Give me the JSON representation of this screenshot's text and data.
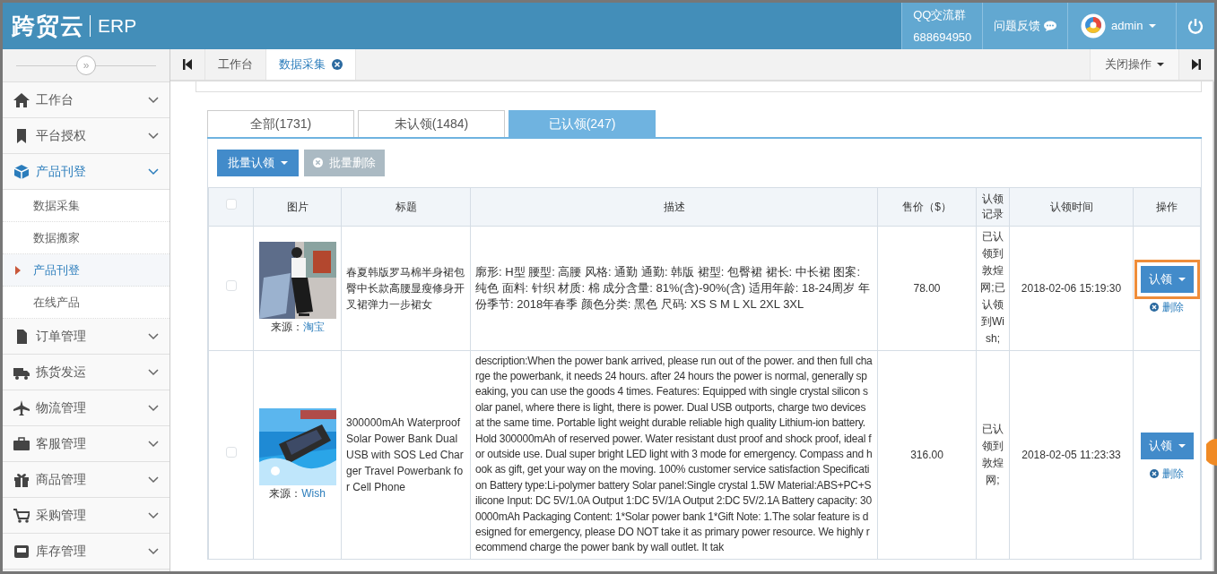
{
  "header": {
    "logo": "跨贸云",
    "product": "ERP",
    "qq_label": "QQ交流群",
    "qq_number": "688694950",
    "feedback": "问题反馈",
    "user": "admin"
  },
  "tab_bar": {
    "tabs": [
      {
        "label": "工作台",
        "selected": false,
        "closable": false
      },
      {
        "label": "数据采集",
        "selected": true,
        "closable": true
      }
    ],
    "close_menu": "关闭操作"
  },
  "sidebar": {
    "collapse": "»",
    "items": [
      {
        "label": "工作台",
        "expanded": false
      },
      {
        "label": "平台授权",
        "expanded": false
      },
      {
        "label": "产品刊登",
        "expanded": true,
        "children": [
          {
            "label": "数据采集",
            "selected": false
          },
          {
            "label": "数据搬家",
            "selected": false
          },
          {
            "label": "产品刊登",
            "selected": true
          },
          {
            "label": "在线产品",
            "selected": false
          }
        ]
      },
      {
        "label": "订单管理",
        "expanded": false
      },
      {
        "label": "拣货发运",
        "expanded": false
      },
      {
        "label": "物流管理",
        "expanded": false
      },
      {
        "label": "客服管理",
        "expanded": false
      },
      {
        "label": "商品管理",
        "expanded": false
      },
      {
        "label": "采购管理",
        "expanded": false
      },
      {
        "label": "库存管理",
        "expanded": false
      }
    ]
  },
  "filter_tabs": [
    {
      "label": "全部(1731)",
      "selected": false
    },
    {
      "label": "未认领(1484)",
      "selected": false
    },
    {
      "label": "已认领(247)",
      "selected": true
    }
  ],
  "toolbar": {
    "batch_claim": "批量认领",
    "batch_delete": {
      "label": "批量删除",
      "disabled": true
    }
  },
  "table": {
    "select_all": false,
    "columns": [
      "图片",
      "标题",
      "描述",
      "售价（$）",
      "认领记录",
      "认领时间",
      "操作"
    ],
    "rows": [
      {
        "checked": false,
        "source_label": "来源：",
        "source": "淘宝",
        "title": "春夏韩版罗马棉半身裙包臀中长款高腰显瘦修身开叉裙弹力一步裙女",
        "description": "廓形: H型 腰型: 高腰 风格: 通勤 通勤: 韩版 裙型: 包臀裙 裙长: 中长裙 图案: 纯色 面料: 针织 材质: 棉 成分含量: 81%(含)-90%(含) 适用年龄: 18-24周岁 年份季节: 2018年春季 颜色分类: 黑色 尺码: XS S M L XL 2XL 3XL",
        "price": "78.00",
        "claim_record": "已认领到敦煌网;已认领到Wish;",
        "claim_time": "2018-02-06 15:19:30",
        "action": "认领",
        "delete": "删除",
        "highlighted": true
      },
      {
        "checked": false,
        "source_label": "来源：",
        "source": "Wish",
        "title": "300000mAh Waterproof Solar Power Bank Dual USB with SOS Led Charger Travel Powerbank for Cell Phone",
        "description": "description:When the power bank arrived, please run out of the power. and then full charge the powerbank, it needs 24 hours. after 24 hours the power is normal, generally speaking, you can use the goods 4 times. Features: Equipped with single crystal silicon solar panel, where there is light, there is power. Dual USB outports, charge two devices at the same time. Portable light weight durable reliable high quality Lithium-ion battery. Hold 300000mAh of reserved power. Water resistant dust proof and shock proof, ideal for outside use. Dual super bright LED light with 3 mode for emergency. Compass and hook as gift, get your way on the moving. 100% customer service satisfaction Specification Battery type:Li-polymer battery Solar panel:Single crystal 1.5W Material:ABS+PC+Silicone Input: DC 5V/1.0A Output 1:DC 5V/1A Output 2:DC 5V/2.1A Battery capacity: 300000mAh Packaging Content: 1*Solar power bank 1*Gift Note: 1.The solar feature is designed for emergency, please DO NOT take it as primary power resource. We highly recommend charge the power bank by wall outlet. It tak",
        "price": "316.00",
        "claim_record": "已认领到敦煌网;",
        "claim_time": "2018-02-05 11:23:33",
        "action": "认领",
        "delete": "删除",
        "highlighted": false
      }
    ]
  }
}
